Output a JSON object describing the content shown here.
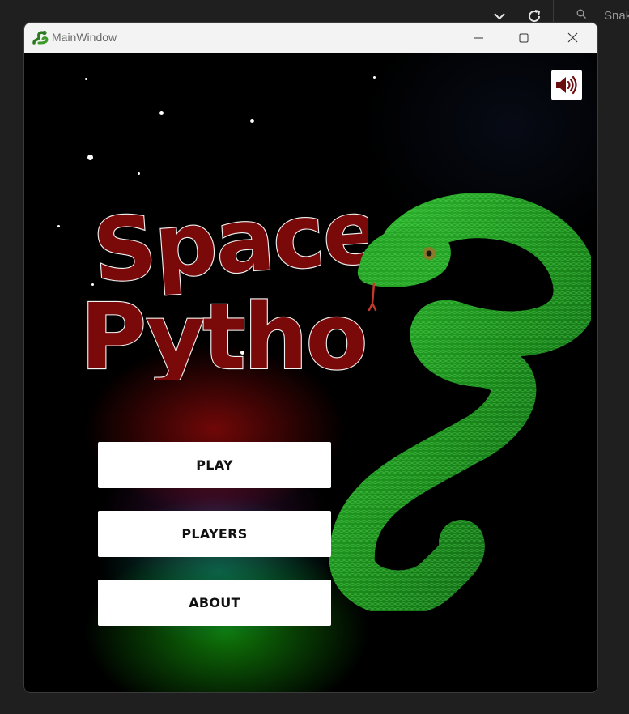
{
  "host": {
    "search_text": "Snak",
    "icons": [
      "chevron-down-icon",
      "refresh-icon",
      "search-icon"
    ]
  },
  "window": {
    "title": "MainWindow",
    "controls": [
      "minimize-icon",
      "maximize-icon",
      "close-icon"
    ]
  },
  "game": {
    "logo_lettering": "Space Python",
    "sound_icon": "speaker-volume-icon",
    "menu": {
      "play_label": "PLAY",
      "players_label": "PLAYERS",
      "about_label": "ABOUT"
    }
  },
  "colors": {
    "logo_red": "#7a0a0a",
    "snake_green": "#1fa01f",
    "sound_icon": "#6b0d0d",
    "background": "#000000"
  }
}
